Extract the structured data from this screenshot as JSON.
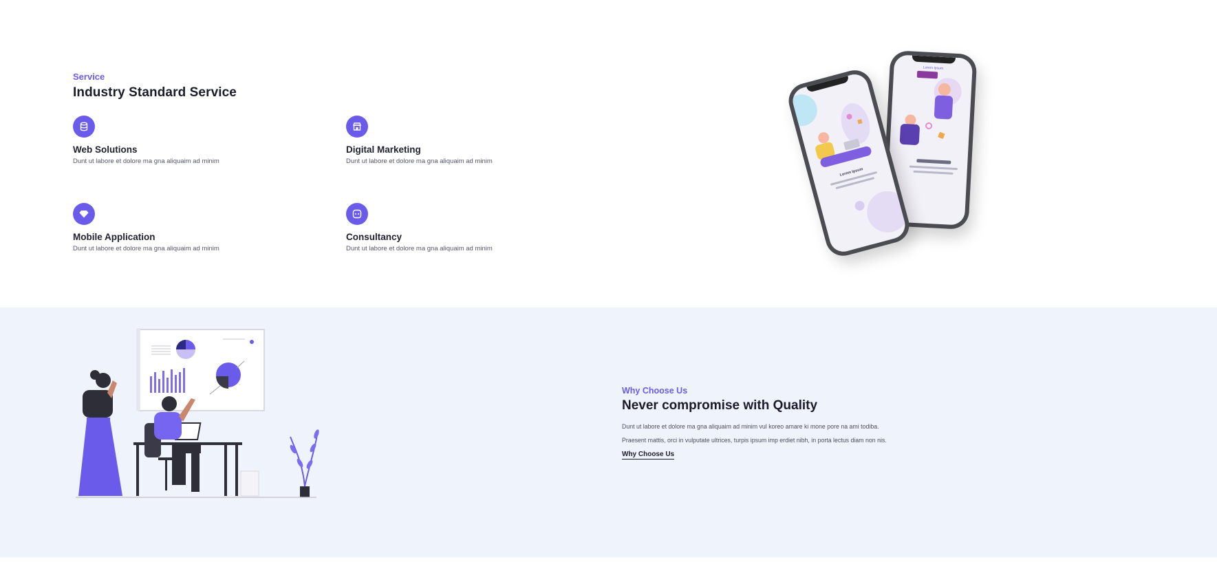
{
  "service": {
    "eyebrow": "Service",
    "title": "Industry Standard Service",
    "items": [
      {
        "title": "Web Solutions",
        "desc": "Dunt ut labore et dolore ma gna aliquaim ad minim",
        "icon": "database-icon"
      },
      {
        "title": "Digital Marketing",
        "desc": "Dunt ut labore et dolore ma gna aliquaim ad minim",
        "icon": "store-icon"
      },
      {
        "title": "Mobile Application",
        "desc": "Dunt ut labore et dolore ma gna aliquaim ad minim",
        "icon": "diamond-icon"
      },
      {
        "title": "Consultancy",
        "desc": "Dunt ut labore et dolore ma gna aliquaim ad minim",
        "icon": "chat-icon"
      }
    ],
    "phone_front_text": "Lorem Ipsum",
    "phone_back_text": "Lorem Ipsum"
  },
  "why": {
    "eyebrow": "Why Choose Us",
    "title": "Never compromise with Quality",
    "para1": "Dunt ut labore et dolore ma gna aliquaim ad minim vul koreo amare ki mone pore na ami todiba.",
    "para2": "Praesent mattis, orci in vulputate ultrices, turpis ipsum imp erdiet nibh, in porta lectus diam non nis.",
    "link": "Why Choose Us"
  },
  "colors": {
    "accent": "#6a5bea",
    "section_bg": "#eff3fb",
    "heading": "#1a1a2b"
  }
}
